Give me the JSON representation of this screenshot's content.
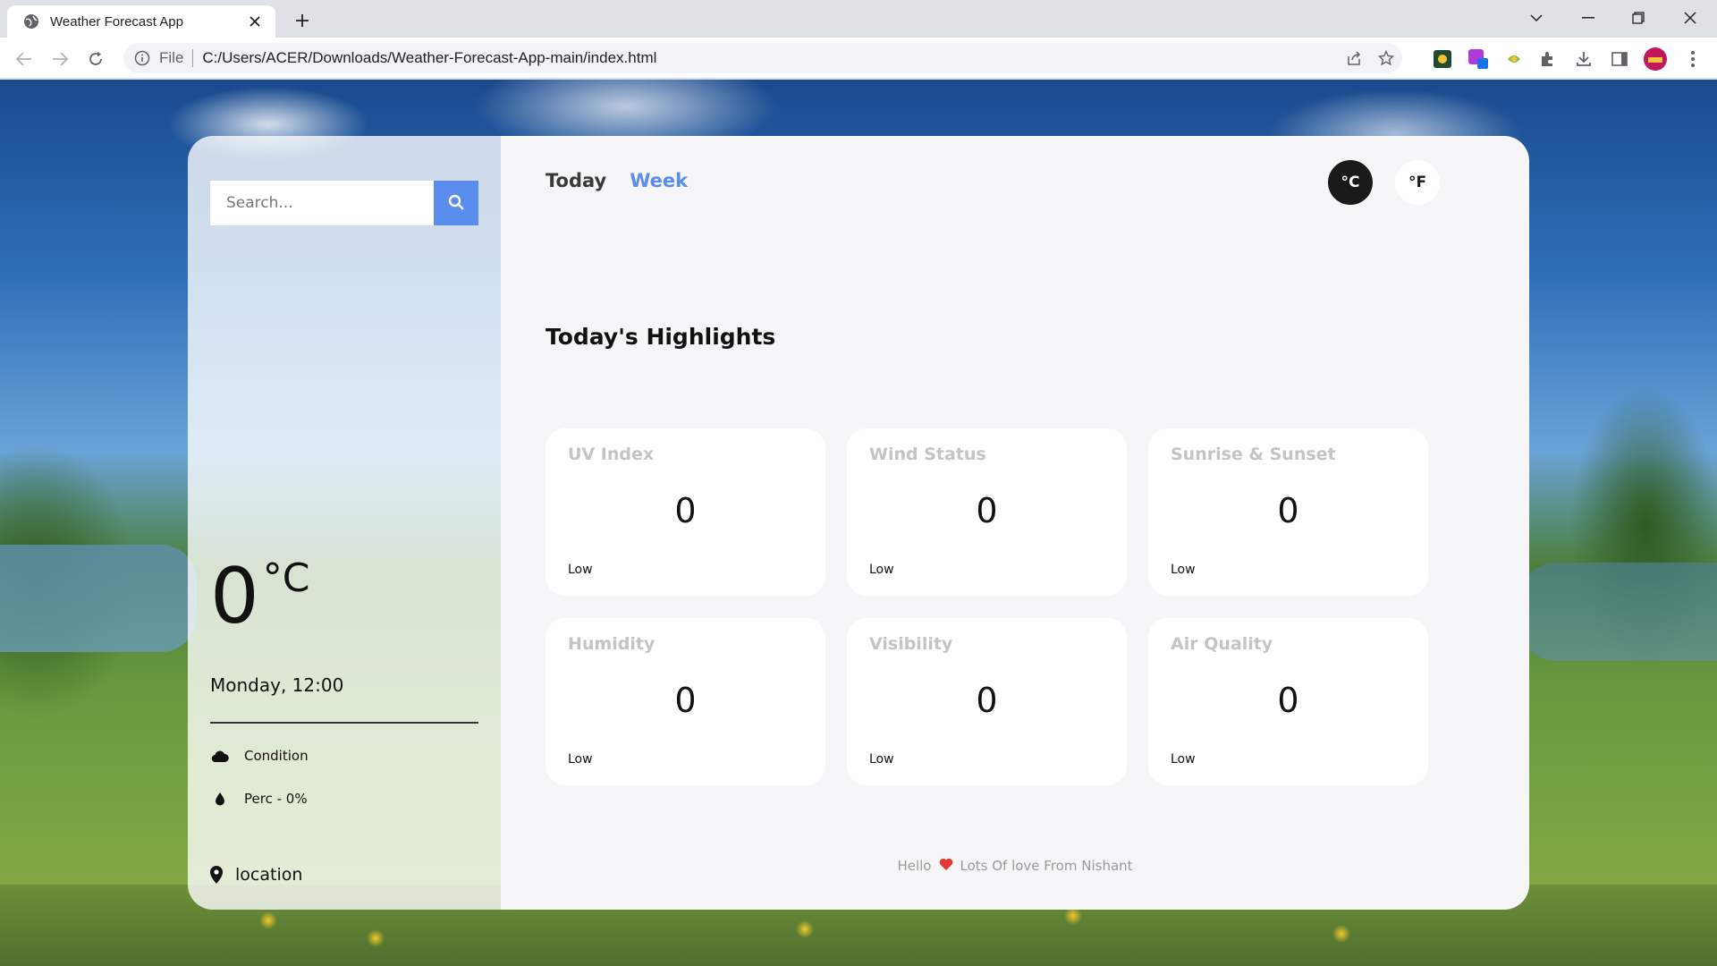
{
  "browser": {
    "tab_title": "Weather Forecast App",
    "omnibox_scheme": "File",
    "url": "C:/Users/ACER/Downloads/Weather-Forecast-App-main/index.html"
  },
  "sidebar": {
    "search_placeholder": "Search...",
    "temperature": "0",
    "temperature_unit": "°C",
    "datetime": "Monday, 12:00",
    "condition": "Condition",
    "precipitation": "Perc - 0%",
    "location": "location"
  },
  "main": {
    "tabs": [
      {
        "label": "Today"
      },
      {
        "label": "Week"
      }
    ],
    "units": {
      "celsius": "°C",
      "fahrenheit": "°F"
    },
    "heading": "Today's Highlights",
    "highlights": [
      {
        "title": "UV Index",
        "value": "0",
        "status": "Low"
      },
      {
        "title": "Wind Status",
        "value": "0",
        "status": "Low"
      },
      {
        "title": "Sunrise & Sunset",
        "value": "0",
        "status": "Low"
      },
      {
        "title": "Humidity",
        "value": "0",
        "status": "Low"
      },
      {
        "title": "Visibility",
        "value": "0",
        "status": "Low"
      },
      {
        "title": "Air Quality",
        "value": "0",
        "status": "Low"
      }
    ],
    "footer": {
      "left": "Hello",
      "right": "Lots Of love From Nishant"
    }
  },
  "colors": {
    "accent": "#5a8dee",
    "heart": "#e53935",
    "unit_active_bg": "#1a1a1a"
  }
}
